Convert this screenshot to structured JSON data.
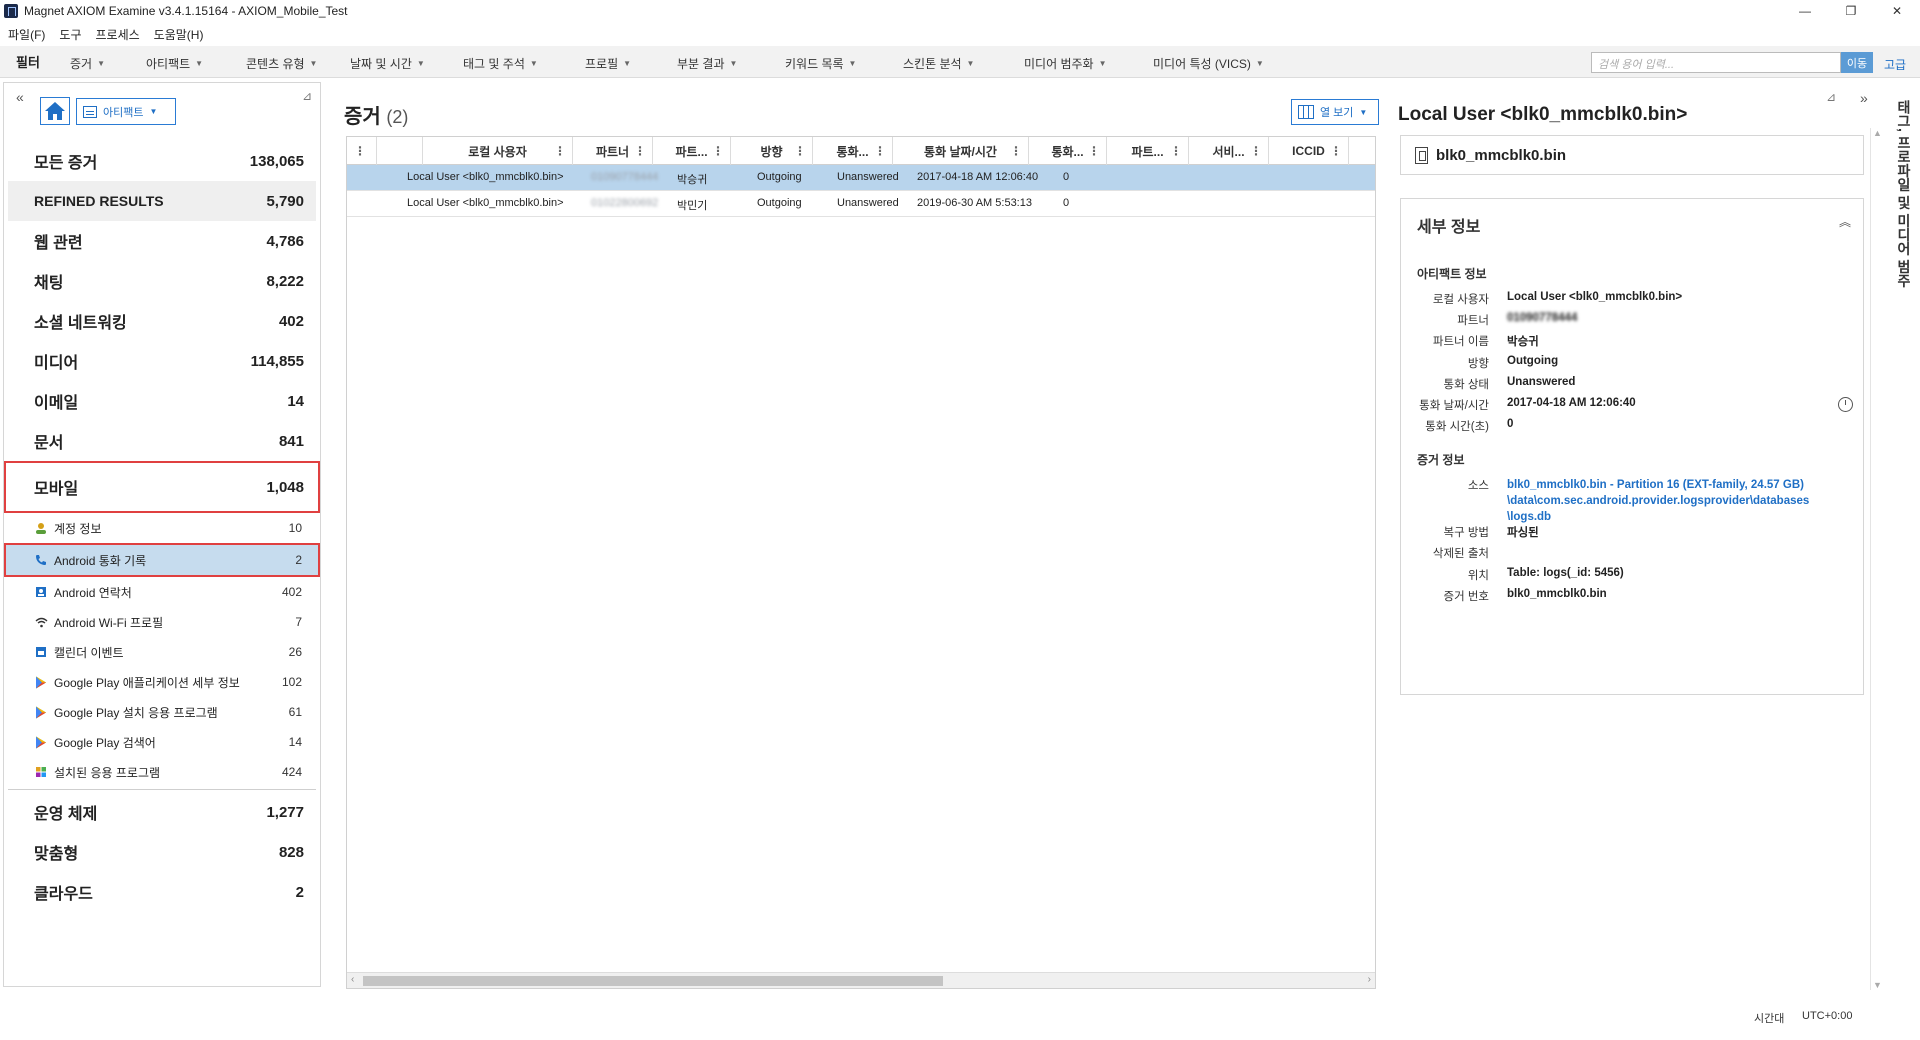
{
  "window": {
    "title": "Magnet AXIOM Examine v3.4.1.15164 - AXIOM_Mobile_Test",
    "controls": [
      "—",
      "❐",
      "✕"
    ]
  },
  "menu": [
    "파일(F)",
    "도구",
    "프로세스",
    "도움말(H)"
  ],
  "filterbar": {
    "label": "필터",
    "items": [
      "증거",
      "아티팩트",
      "콘텐츠 유형",
      "날짜 및 시간",
      "태그 및 주석",
      "프로필",
      "부분 결과",
      "키워드 목록",
      "스킨톤 분석",
      "미디어 범주화",
      "미디어 특성 (VICS)"
    ],
    "search_placeholder": "검색 용어 입력...",
    "go_label": "이동",
    "advanced_label": "고급"
  },
  "left": {
    "view_label": "아티팩트",
    "categories": [
      {
        "label": "모든 증거",
        "count": "138,065"
      },
      {
        "label": "REFINED RESULTS",
        "count": "5,790"
      },
      {
        "label": "웹 관련",
        "count": "4,786"
      },
      {
        "label": "채팅",
        "count": "8,222"
      },
      {
        "label": "소셜 네트워킹",
        "count": "402"
      },
      {
        "label": "미디어",
        "count": "114,855"
      },
      {
        "label": "이메일",
        "count": "14"
      },
      {
        "label": "문서",
        "count": "841"
      },
      {
        "label": "모바일",
        "count": "1,048"
      }
    ],
    "mobile_items": [
      {
        "label": "계정 정보",
        "count": "10",
        "icon": "account-icon"
      },
      {
        "label": "Android 통화 기록",
        "count": "2",
        "icon": "phone-icon"
      },
      {
        "label": "Android 연락처",
        "count": "402",
        "icon": "contact-icon"
      },
      {
        "label": "Android Wi-Fi 프로필",
        "count": "7",
        "icon": "wifi-icon"
      },
      {
        "label": "캘린더 이벤트",
        "count": "26",
        "icon": "calendar-icon"
      },
      {
        "label": "Google Play 애플리케이션 세부 정보",
        "count": "102",
        "icon": "google-play-icon"
      },
      {
        "label": "Google Play 설치 응용 프로그램",
        "count": "61",
        "icon": "google-play-icon"
      },
      {
        "label": "Google Play 검색어",
        "count": "14",
        "icon": "google-play-icon"
      },
      {
        "label": "설치된 응용 프로그램",
        "count": "424",
        "icon": "apps-icon"
      }
    ],
    "bottom_categories": [
      {
        "label": "운영 체제",
        "count": "1,277"
      },
      {
        "label": "맞춤형",
        "count": "828"
      },
      {
        "label": "클라우드",
        "count": "2"
      }
    ]
  },
  "center": {
    "title": "증거",
    "count": "(2)",
    "column_view_label": "열 보기",
    "columns": [
      "로컬 사용자",
      "파트너",
      "파트...",
      "방향",
      "통화...",
      "통화 날짜/시간",
      "통화...",
      "파트...",
      "서비...",
      "ICCID"
    ],
    "rows": [
      {
        "local_user": "Local User <blk0_mmcblk0.bin>",
        "partner": "01090778444",
        "partner_name": "박승귀",
        "direction": "Outgoing",
        "status": "Unanswered",
        "datetime": "2017-04-18 AM 12:06:40",
        "duration": "0"
      },
      {
        "local_user": "Local User <blk0_mmcblk0.bin>",
        "partner": "01022800692",
        "partner_name": "박민기",
        "direction": "Outgoing",
        "status": "Unanswered",
        "datetime": "2019-06-30 AM 5:53:13",
        "duration": "0"
      }
    ]
  },
  "right": {
    "title": "Local User <blk0_mmcblk0.bin>",
    "file_name": "blk0_mmcblk0.bin",
    "details_head": "세부 정보",
    "artifact_section": "아티팩트 정보",
    "artifact_fields": [
      {
        "k": "로컬 사용자",
        "v": "Local User <blk0_mmcblk0.bin>"
      },
      {
        "k": "파트너",
        "v": "01090778444"
      },
      {
        "k": "파트너 이름",
        "v": "박승귀"
      },
      {
        "k": "방향",
        "v": "Outgoing"
      },
      {
        "k": "통화 상태",
        "v": "Unanswered"
      },
      {
        "k": "통화 날짜/시간",
        "v": "2017-04-18 AM 12:06:40"
      },
      {
        "k": "통화 시간(초)",
        "v": "0"
      }
    ],
    "evidence_section": "증거 정보",
    "source_label": "소스",
    "source_value": "blk0_mmcblk0.bin - Partition 16 (EXT-family, 24.57 GB) \\data\\com.sec.android.provider.logsprovider\\databases \\logs.db",
    "evidence_fields": [
      {
        "k": "복구 방법",
        "v": "파싱된"
      },
      {
        "k": "삭제된 출처",
        "v": ""
      },
      {
        "k": "위치",
        "v": "Table: logs(_id: 5456)"
      },
      {
        "k": "증거 번호",
        "v": "blk0_mmcblk0.bin"
      }
    ],
    "side_tab": "태그, 프로파일 및 미디어 범주"
  },
  "status": {
    "tz_label": "시간대",
    "tz_value": "UTC+0:00"
  },
  "colors": {
    "accent": "#2a7bd4",
    "selection": "#b8d4ec",
    "highlight_border": "#e04040"
  }
}
